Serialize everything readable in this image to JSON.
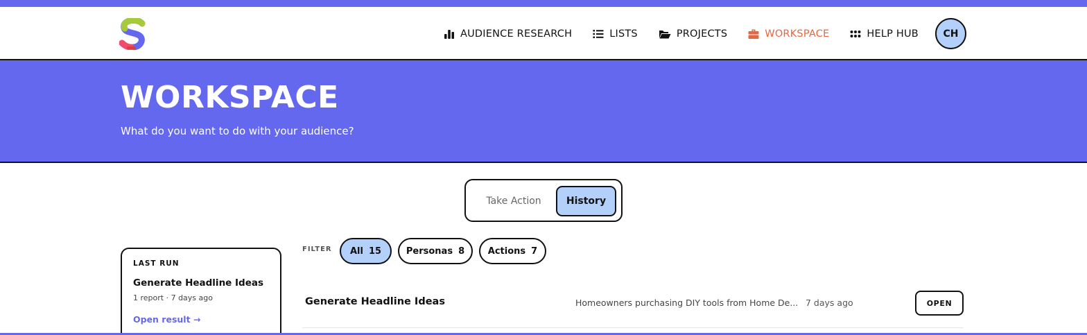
{
  "colors": {
    "brand": "#6468ef",
    "accent_active_nav": "#e8663f",
    "chip_active": "#b3d0fb",
    "avatar_bg": "#b3d0fb"
  },
  "nav": {
    "items": [
      {
        "label": "AUDIENCE RESEARCH",
        "icon": "bar-chart-icon"
      },
      {
        "label": "LISTS",
        "icon": "list-icon"
      },
      {
        "label": "PROJECTS",
        "icon": "folder-open-icon"
      },
      {
        "label": "WORKSPACE",
        "icon": "briefcase-icon",
        "active": true
      },
      {
        "label": "HELP HUB",
        "icon": "grid-dots-icon"
      }
    ],
    "avatar_initials": "CH"
  },
  "hero": {
    "title": "WORKSPACE",
    "subtitle": "What do you want to do with your audience?"
  },
  "toggle": {
    "options": [
      "Take Action",
      "History"
    ],
    "selected": "History"
  },
  "last_run": {
    "label": "LAST RUN",
    "title": "Generate Headline Ideas",
    "meta": "1 report · 7 days ago",
    "link": "Open result →"
  },
  "filter": {
    "label": "FILTER",
    "chips": [
      {
        "label": "All",
        "count": "15",
        "active": true
      },
      {
        "label": "Personas",
        "count": "8"
      },
      {
        "label": "Actions",
        "count": "7"
      }
    ]
  },
  "history": {
    "rows": [
      {
        "title": "Generate Headline Ideas",
        "description": "Homeowners purchasing DIY tools from Home De...",
        "time": "7 days ago",
        "action": "OPEN"
      }
    ]
  }
}
